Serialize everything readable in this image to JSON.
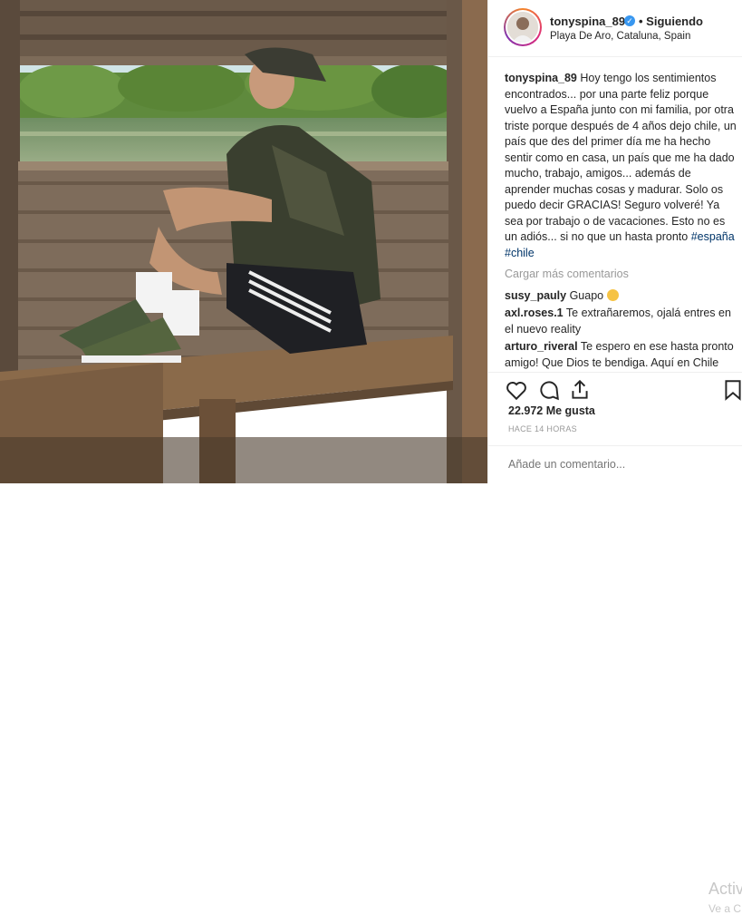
{
  "post": {
    "username": "tonyspina_89",
    "follow_status": "• Siguiendo",
    "location": "Playa De Aro, Cataluna, Spain",
    "caption_user": "tonyspina_89",
    "caption_text": "Hoy tengo los sentimientos encontrados... por una parte feliz porque vuelvo a España junto con mi familia, por otra triste porque después de 4 años dejo chile, un país que des del primer día me ha hecho sentir como en casa, un país que me ha dado mucho, trabajo, amigos... además de aprender muchas cosas y madurar. Solo os puedo decir GRACIAS! Seguro volveré! Ya sea por trabajo o de vacaciones. Esto no es un adiós... si no que un hasta pronto",
    "hashtags": "#españa #chile",
    "load_more": "Cargar más comentarios",
    "comments": [
      {
        "user": "susy_pauly",
        "text": "Guapo",
        "emoji": "heart-eyes-emoji"
      },
      {
        "user": "axl.roses.1",
        "text": "Te extrañaremos, ojalá entres en el nuevo reality"
      },
      {
        "user": "arturo_riveral",
        "text": "Te espero en ese hasta pronto amigo! Que Dios te bendiga. Aquí en Chile seguiremos esperándote",
        "emoji": "flexed-bicep-emoji"
      }
    ],
    "likes": "22.972 Me gusta",
    "time": "HACE 14 HORAS",
    "comment_placeholder": "Añade un comentario...",
    "icons": [
      "heart-icon",
      "comment-icon",
      "share-icon",
      "bookmark-icon"
    ]
  },
  "watermark": {
    "line1": "Activ",
    "line2": "Ve a C"
  },
  "colors": {
    "link": "#003569",
    "verified": "#3897f0",
    "muted": "#999999",
    "text": "#262626"
  }
}
